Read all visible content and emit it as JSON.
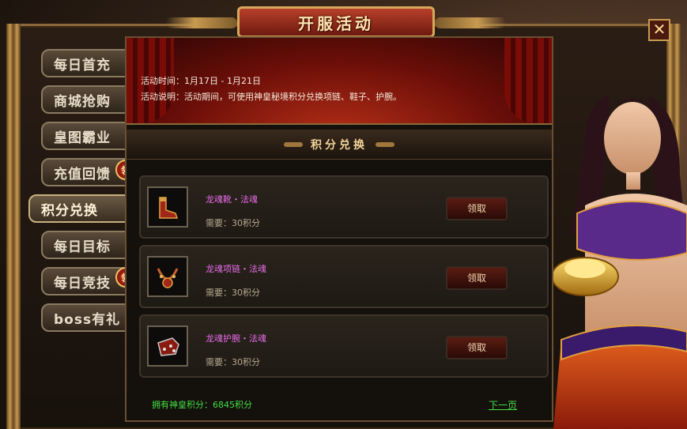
{
  "window": {
    "title": "开服活动",
    "close_label": "✕"
  },
  "sidebar": {
    "tabs": [
      {
        "label": "每日首充",
        "badge": ""
      },
      {
        "label": "商城抢购",
        "badge": ""
      },
      {
        "label": "皇图霸业",
        "badge": ""
      },
      {
        "label": "充值回馈",
        "badge": "领"
      },
      {
        "label": "积分兑换",
        "badge": "",
        "active": true
      },
      {
        "label": "每日目标",
        "badge": ""
      },
      {
        "label": "每日竞技",
        "badge": "领"
      },
      {
        "label": "boss有礼",
        "badge": ""
      }
    ]
  },
  "event": {
    "time_text": "活动时间：1月17日 - 1月21日",
    "desc_text": "活动说明：活动期间，可使用神皇秘境积分兑换项链、鞋子、护腕。"
  },
  "section": {
    "title": "积分兑换"
  },
  "items": [
    {
      "name": "龙魂靴・法魂",
      "cost": "需要：30积分",
      "button": "领取",
      "icon": "boots-icon"
    },
    {
      "name": "龙魂项链・法魂",
      "cost": "需要：30积分",
      "button": "领取",
      "icon": "necklace-icon"
    },
    {
      "name": "龙魂护腕・法魂",
      "cost": "需要：30积分",
      "button": "领取",
      "icon": "bracer-icon"
    }
  ],
  "footer": {
    "points_text": "拥有神皇积分：6845积分",
    "next_page": "下一页"
  },
  "colors": {
    "item_name": "#e86ce8",
    "points": "#44dd44",
    "accent": "#c89a50"
  }
}
